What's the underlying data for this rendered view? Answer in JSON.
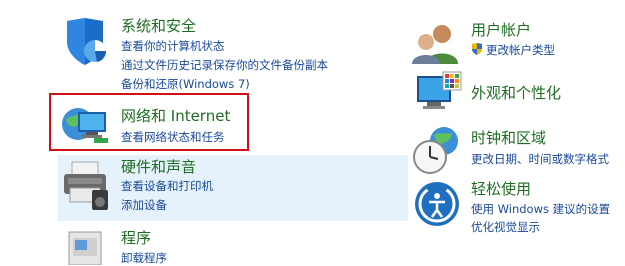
{
  "categories": {
    "system_security": {
      "title": "系统和安全",
      "links": [
        "查看你的计算机状态",
        "通过文件历史记录保存你的文件备份副本",
        "备份和还原(Windows 7)"
      ]
    },
    "network_internet": {
      "title": "网络和 Internet",
      "links": [
        "查看网络状态和任务"
      ]
    },
    "hardware_sound": {
      "title": "硬件和声音",
      "links": [
        "查看设备和打印机",
        "添加设备"
      ]
    },
    "programs": {
      "title": "程序",
      "links": [
        "卸载程序"
      ]
    },
    "user_accounts": {
      "title": "用户帐户",
      "links": [
        "更改帐户类型"
      ]
    },
    "appearance": {
      "title": "外观和个性化",
      "links": []
    },
    "clock_region": {
      "title": "时钟和区域",
      "links": [
        "更改日期、时间或数字格式"
      ]
    },
    "ease_of_access": {
      "title": "轻松使用",
      "links": [
        "使用 Windows 建议的设置",
        "优化视觉显示"
      ]
    }
  },
  "colors": {
    "title_green": "#1e6e23",
    "link_blue": "#1a4a9a",
    "highlight_red": "#d10f14",
    "hover_bg": "#e5f1fb"
  }
}
